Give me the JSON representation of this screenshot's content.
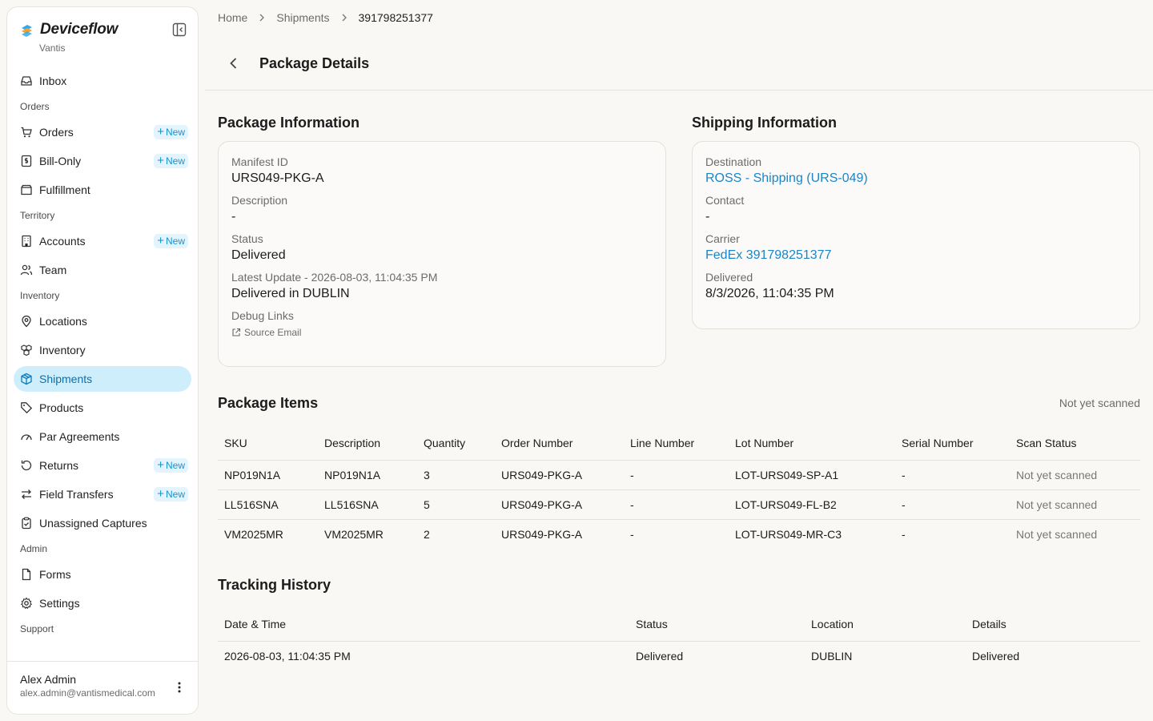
{
  "app": {
    "name": "Deviceflow",
    "org": "Vantis"
  },
  "sidebar": {
    "items": [
      {
        "label": "Inbox",
        "icon": "inbox-icon"
      },
      {
        "section": "Orders"
      },
      {
        "label": "Orders",
        "icon": "cart-icon",
        "badge": "New"
      },
      {
        "label": "Bill-Only",
        "icon": "invoice-icon",
        "badge": "New"
      },
      {
        "label": "Fulfillment",
        "icon": "box-open-icon"
      },
      {
        "section": "Territory"
      },
      {
        "label": "Accounts",
        "icon": "building-icon",
        "badge": "New"
      },
      {
        "label": "Team",
        "icon": "users-icon"
      },
      {
        "section": "Inventory"
      },
      {
        "label": "Locations",
        "icon": "map-pin-icon"
      },
      {
        "label": "Inventory",
        "icon": "boxes-icon"
      },
      {
        "label": "Shipments",
        "icon": "package-icon",
        "active": true
      },
      {
        "label": "Products",
        "icon": "tag-icon"
      },
      {
        "label": "Par Agreements",
        "icon": "gauge-icon"
      },
      {
        "label": "Returns",
        "icon": "rotate-icon",
        "badge": "New"
      },
      {
        "label": "Field Transfers",
        "icon": "transfer-icon",
        "badge": "New"
      },
      {
        "label": "Unassigned Captures",
        "icon": "clipboard-check-icon"
      },
      {
        "section": "Admin"
      },
      {
        "label": "Forms",
        "icon": "file-icon"
      },
      {
        "label": "Settings",
        "icon": "gear-icon"
      },
      {
        "section": "Support"
      }
    ]
  },
  "user": {
    "name": "Alex Admin",
    "email": "alex.admin@vantismedical.com"
  },
  "breadcrumb": {
    "home": "Home",
    "shipments": "Shipments",
    "current": "391798251377"
  },
  "page": {
    "title": "Package Details"
  },
  "package_info": {
    "title": "Package Information",
    "manifest_label": "Manifest ID",
    "manifest_value": "URS049-PKG-A",
    "description_label": "Description",
    "description_value": "-",
    "status_label": "Status",
    "status_value": "Delivered",
    "update_label": "Latest Update - 2026-08-03, 11:04:35 PM",
    "update_value": "Delivered in DUBLIN",
    "debug_label": "Debug Links",
    "source_email": "Source Email"
  },
  "shipping_info": {
    "title": "Shipping Information",
    "destination_label": "Destination",
    "destination_value": "ROSS - Shipping (URS-049)",
    "contact_label": "Contact",
    "contact_value": "-",
    "carrier_label": "Carrier",
    "carrier_value": "FedEx 391798251377",
    "delivered_label": "Delivered",
    "delivered_value": "8/3/2026, 11:04:35 PM"
  },
  "package_items": {
    "title": "Package Items",
    "note": "Not yet scanned",
    "columns": [
      "SKU",
      "Description",
      "Quantity",
      "Order Number",
      "Line Number",
      "Lot Number",
      "Serial Number",
      "Scan Status"
    ],
    "rows": [
      [
        "NP019N1A",
        "NP019N1A",
        "3",
        "URS049-PKG-A",
        "-",
        "LOT-URS049-SP-A1",
        "-",
        "Not yet scanned"
      ],
      [
        "LL516SNA",
        "LL516SNA",
        "5",
        "URS049-PKG-A",
        "-",
        "LOT-URS049-FL-B2",
        "-",
        "Not yet scanned"
      ],
      [
        "VM2025MR",
        "VM2025MR",
        "2",
        "URS049-PKG-A",
        "-",
        "LOT-URS049-MR-C3",
        "-",
        "Not yet scanned"
      ]
    ]
  },
  "tracking": {
    "title": "Tracking History",
    "columns": [
      "Date & Time",
      "Status",
      "Location",
      "Details"
    ],
    "rows": [
      [
        "2026-08-03, 11:04:35 PM",
        "Delivered",
        "DUBLIN",
        "Delivered"
      ]
    ]
  },
  "colors": {
    "accent": "#1a86c8",
    "active_bg": "#cfeefc",
    "background": "#f9f8f5"
  }
}
